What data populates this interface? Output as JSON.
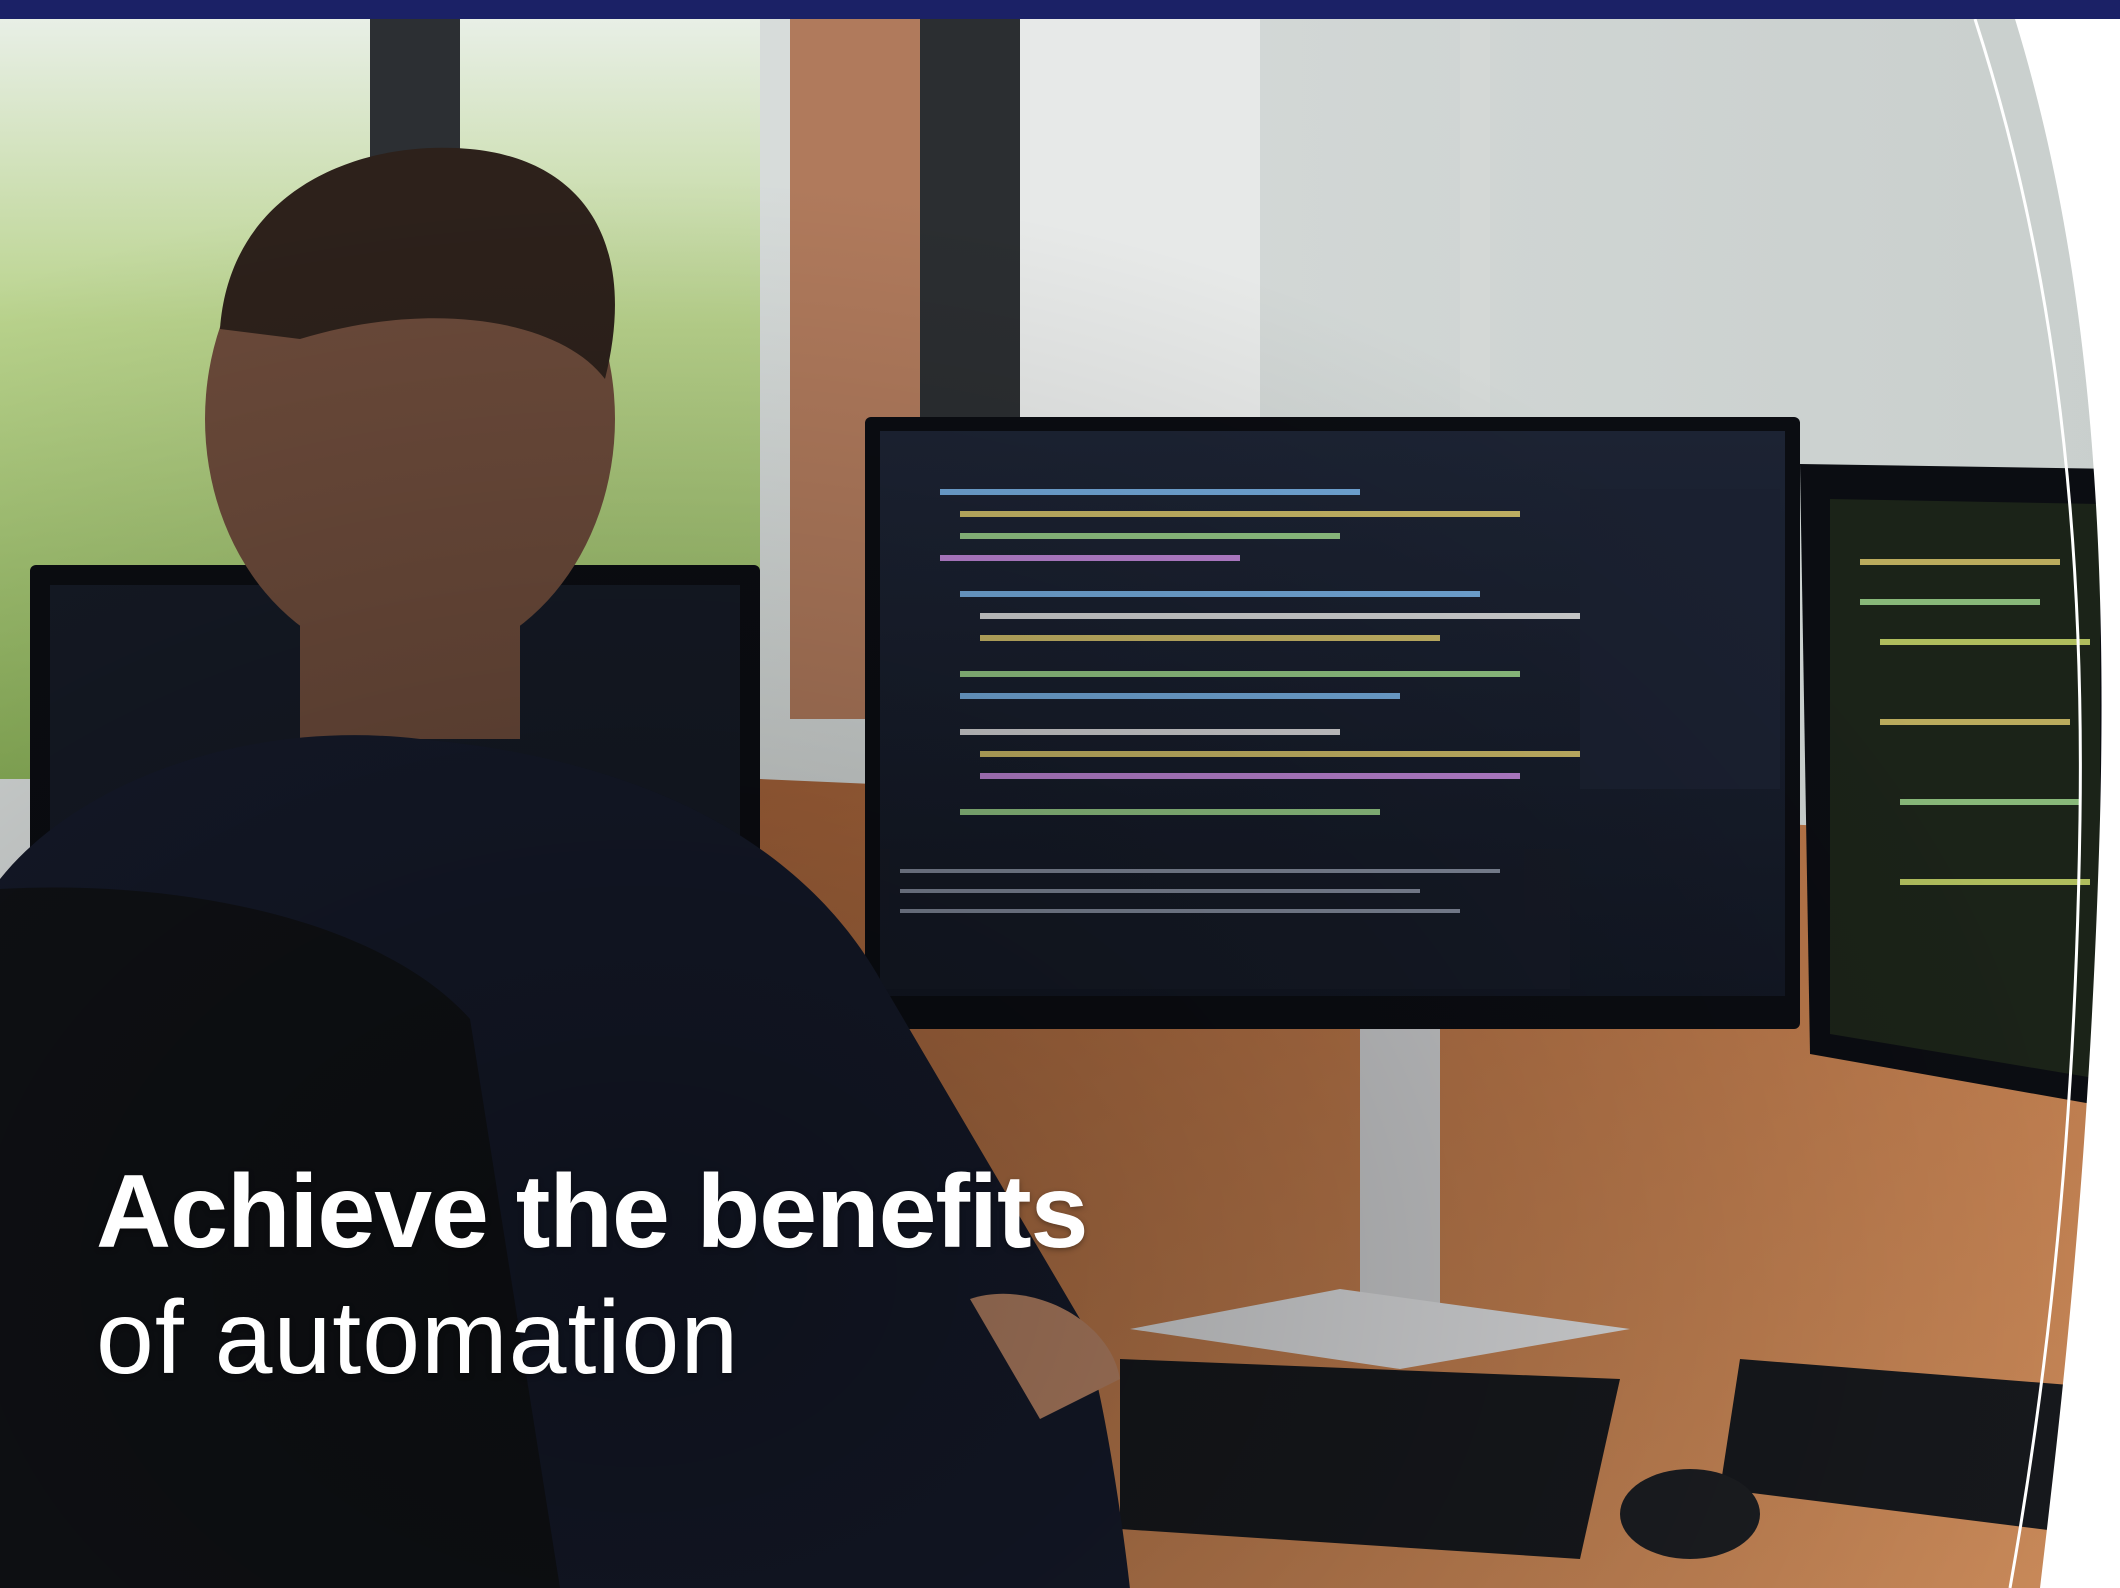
{
  "hero": {
    "headline_bold": "Achieve the benefits",
    "headline_light": "of automation"
  },
  "colors": {
    "top_band": "#1b2166",
    "side_panel": "#ffffff",
    "divider_line": "#ffffff",
    "headline_text": "#ffffff"
  },
  "scene": {
    "subject": "person-from-behind",
    "objects": [
      "monitor-left",
      "monitor-center-code-editor",
      "monitor-right",
      "keyboard",
      "mouse",
      "desk",
      "window",
      "office-chair"
    ]
  }
}
